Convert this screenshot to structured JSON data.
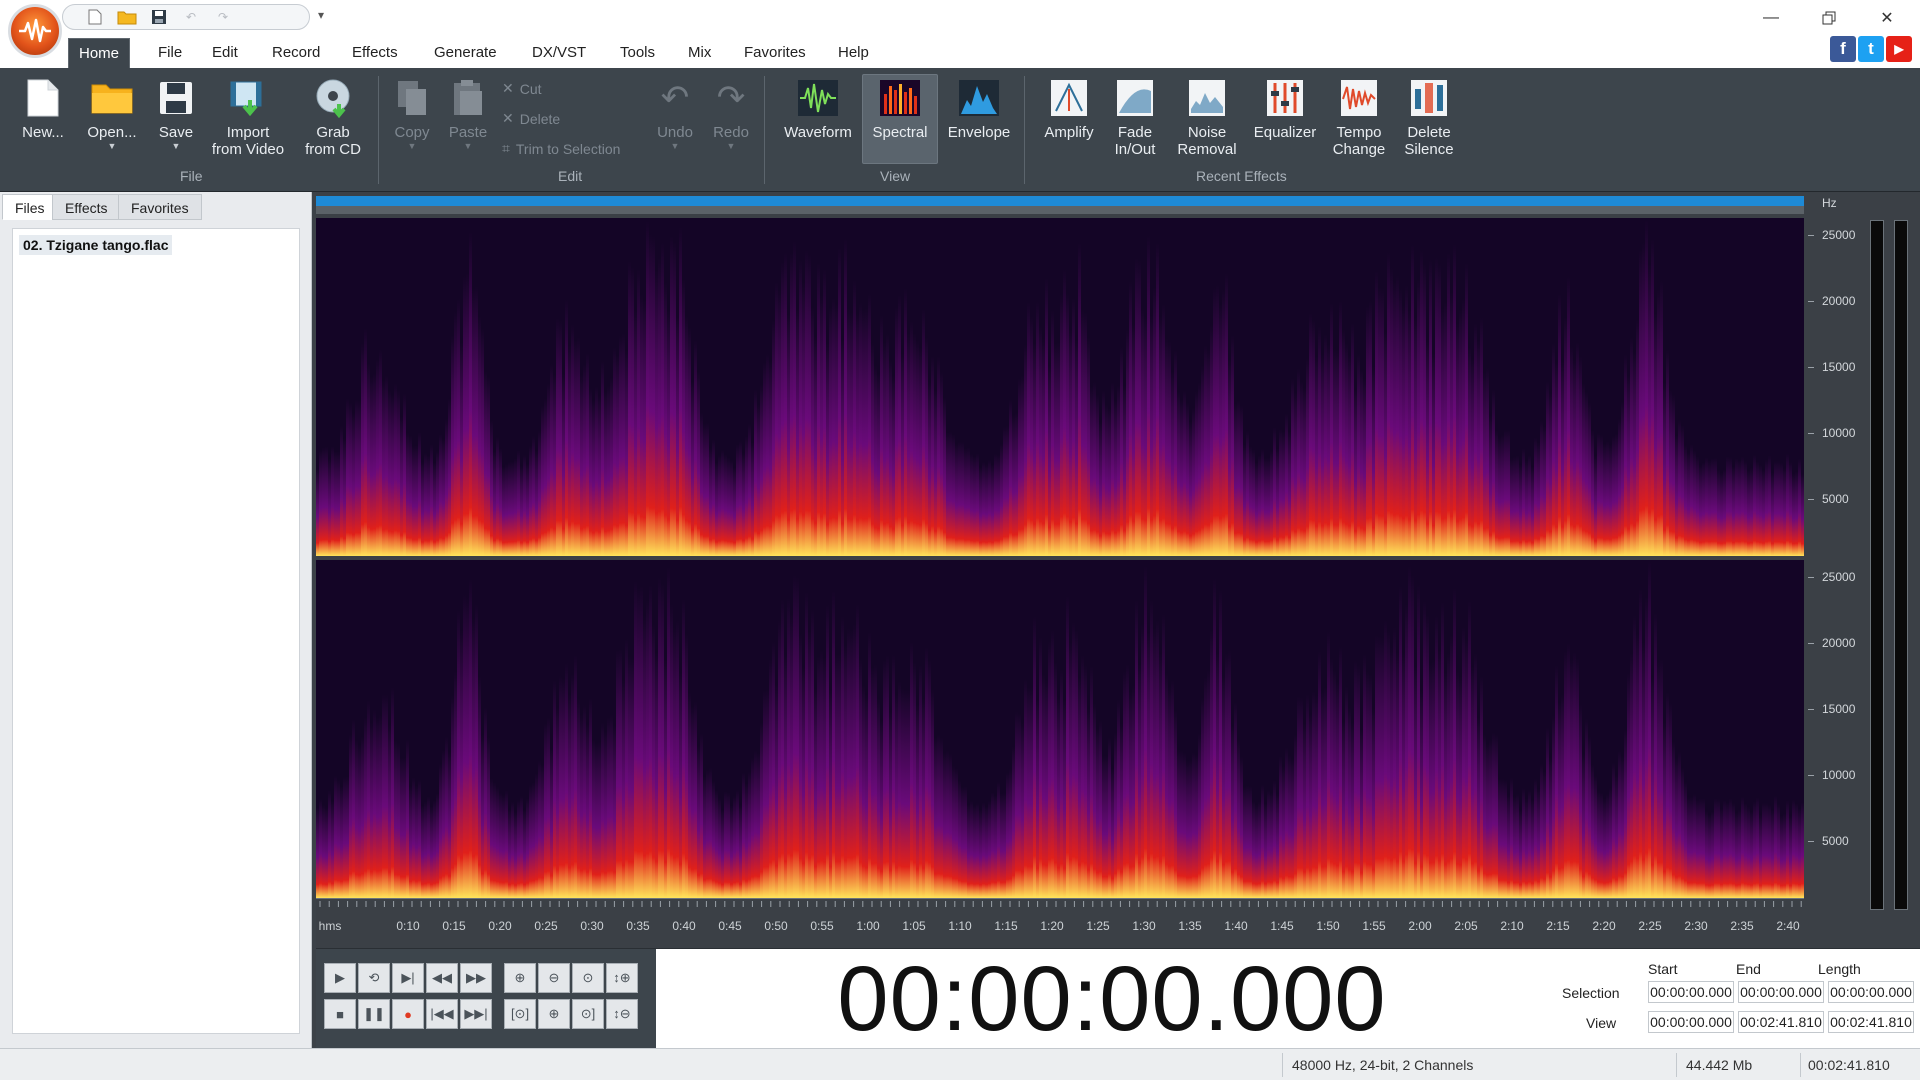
{
  "titlebar": {
    "qat_icons": [
      "new-icon",
      "open-folder-icon",
      "save-icon",
      "undo-icon",
      "redo-icon"
    ],
    "customize_glyph": "▾"
  },
  "menu": {
    "tabs": [
      "Home",
      "File",
      "Edit",
      "Record",
      "Effects",
      "Generate",
      "DX/VST",
      "Tools",
      "Mix",
      "Favorites",
      "Help"
    ],
    "active": "Home"
  },
  "social": {
    "facebook": "f",
    "twitter": "t",
    "youtube": "▶"
  },
  "ribbon": {
    "file_group": {
      "label": "File",
      "new": "New...",
      "open": "Open...",
      "save": "Save",
      "import_1": "Import",
      "import_2": "from Video",
      "grab_1": "Grab",
      "grab_2": "from CD"
    },
    "edit_group": {
      "label": "Edit",
      "copy": "Copy",
      "paste": "Paste",
      "cut": "Cut",
      "delete": "Delete",
      "trim": "Trim to Selection",
      "undo": "Undo",
      "redo": "Redo"
    },
    "view_group": {
      "label": "View",
      "waveform": "Waveform",
      "spectral": "Spectral",
      "envelope": "Envelope"
    },
    "effects_group": {
      "label": "Recent Effects",
      "amplify": "Amplify",
      "fade_1": "Fade",
      "fade_2": "In/Out",
      "noise_1": "Noise",
      "noise_2": "Removal",
      "equalizer": "Equalizer",
      "tempo_1": "Tempo",
      "tempo_2": "Change",
      "silence_1": "Delete",
      "silence_2": "Silence"
    }
  },
  "left_panel": {
    "tabs": [
      "Files",
      "Effects",
      "Favorites"
    ],
    "active_tab": "Files",
    "files": [
      "02. Tzigane tango.flac"
    ]
  },
  "spectrogram": {
    "hz_unit": "Hz",
    "hz_labels": [
      "25000",
      "20000",
      "15000",
      "10000",
      "5000"
    ],
    "time_unit": "hms",
    "time_labels": [
      "0:10",
      "0:15",
      "0:20",
      "0:25",
      "0:30",
      "0:35",
      "0:40",
      "0:45",
      "0:50",
      "0:55",
      "1:00",
      "1:05",
      "1:10",
      "1:15",
      "1:20",
      "1:25",
      "1:30",
      "1:35",
      "1:40",
      "1:45",
      "1:50",
      "1:55",
      "2:00",
      "2:05",
      "2:10",
      "2:15",
      "2:20",
      "2:25",
      "2:30",
      "2:35",
      "2:40"
    ],
    "colors": {
      "background": "#140526",
      "low": "#6a0a7a",
      "mid": "#e0201a",
      "high": "#ffe45a"
    }
  },
  "transport": {
    "time_display": "00:00:00.000",
    "row1_icons": [
      "play-icon",
      "loop-icon",
      "play-to-end-icon",
      "rewind-icon",
      "fast-forward-icon"
    ],
    "row2_icons": [
      "stop-icon",
      "pause-icon",
      "record-icon",
      "go-to-start-icon",
      "go-to-end-icon"
    ],
    "zoom_row1_icons": [
      "zoom-in-icon",
      "zoom-out-icon",
      "zoom-100-icon",
      "zoom-vertical-in-icon"
    ],
    "zoom_row2_icons": [
      "zoom-full-icon",
      "zoom-selection-icon",
      "zoom-fit-icon",
      "zoom-vertical-out-icon"
    ]
  },
  "selection": {
    "headers": [
      "Start",
      "End",
      "Length"
    ],
    "selection_label": "Selection",
    "view_label": "View",
    "selection_start": "00:00:00.000",
    "selection_end": "00:00:00.000",
    "selection_length": "00:00:00.000",
    "view_start": "00:00:00.000",
    "view_end": "00:02:41.810",
    "view_length": "00:02:41.810"
  },
  "status": {
    "format": "48000 Hz, 24-bit, 2 Channels",
    "size": "44.442 Mb",
    "duration": "00:02:41.810"
  }
}
